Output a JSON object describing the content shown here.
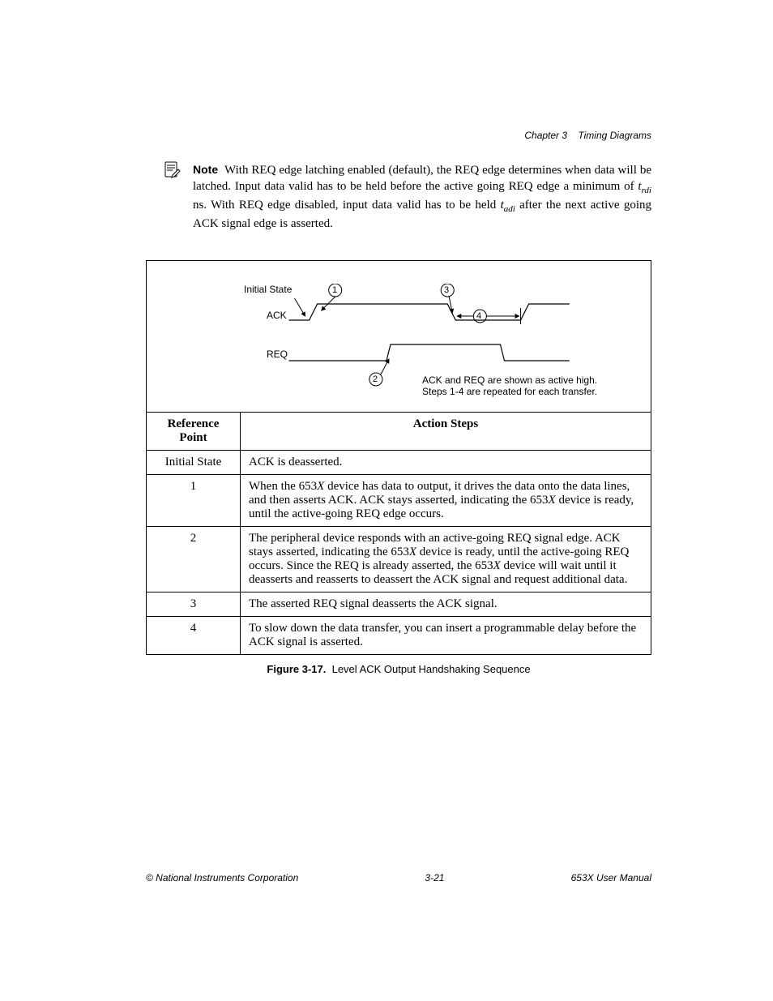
{
  "header": {
    "chapter": "Chapter 3",
    "section": "Timing Diagrams"
  },
  "note": {
    "label": "Note",
    "pre": "With REQ edge latching enabled (default), the REQ edge determines when data will be latched. Input data valid has to be held before the active going REQ edge a minimum of ",
    "sub1": "t",
    "sub1_s": "rdi",
    "mid": " ns. With REQ edge disabled, input data valid has to be held ",
    "sub2": "t",
    "sub2_s": "adi",
    "post": " after the next active going ACK signal edge is asserted."
  },
  "diagram": {
    "initial": "Initial State",
    "ack": "ACK",
    "req": "REQ",
    "n1": "1",
    "n2": "2",
    "n3": "3",
    "n4": "4",
    "note1": "ACK and REQ are shown as active high.",
    "note2": "Steps 1-4 are repeated for each transfer."
  },
  "table": {
    "h1": "Reference Point",
    "h2": "Action Steps",
    "rows": [
      {
        "ref": "Initial State",
        "act": "ACK is deasserted."
      },
      {
        "ref": "1",
        "act": "When the 653X device has data to output, it drives the data onto the data lines, and then asserts ACK. ACK stays asserted, indicating the 653X device is ready, until the active-going REQ edge occurs."
      },
      {
        "ref": "2",
        "act": "The peripheral device responds with an active-going REQ signal edge. ACK stays asserted, indicating the 653X device is ready, until the active-going REQ occurs. Since the REQ is already asserted, the 653X device will wait until it deasserts and reasserts to deassert the ACK signal and request additional data."
      },
      {
        "ref": "3",
        "act": "The asserted REQ signal deasserts the ACK signal."
      },
      {
        "ref": "4",
        "act": "To slow down the data transfer, you can insert a programmable delay before the ACK signal is asserted."
      }
    ]
  },
  "caption": {
    "fig": "Figure 3-17.",
    "text": "Level ACK Output Handshaking Sequence"
  },
  "footer": {
    "left": "© National Instruments Corporation",
    "center": "3-21",
    "right": "653X User Manual"
  }
}
